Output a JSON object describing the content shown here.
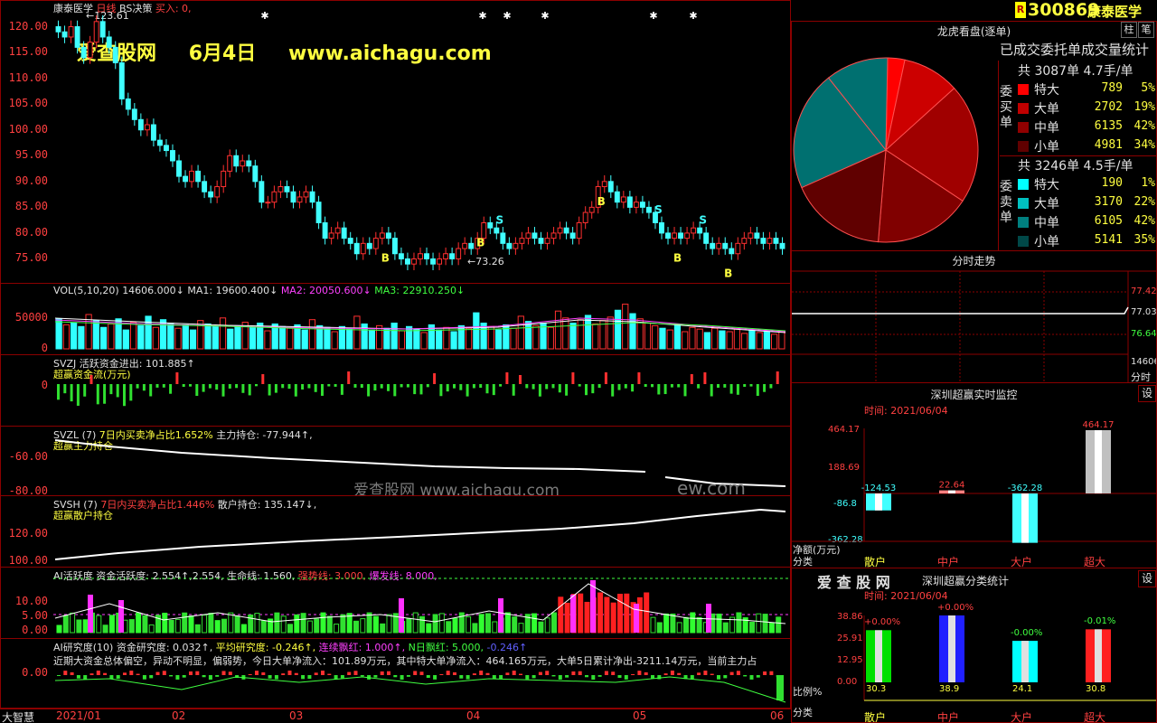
{
  "stock": {
    "code": "300869",
    "name": "康泰医学",
    "period": "日线",
    "strategy": "BS决策",
    "buy_label": "买入: 0,"
  },
  "overlay": {
    "brand": "爱查股网",
    "date": "6月4日",
    "url": "www.aichagu.com",
    "watermark": "爱查股网   www.aichagu.com",
    "watermark2": "ew.com"
  },
  "main_chart": {
    "y_ticks": [
      "120.00",
      "115.00",
      "110.00",
      "105.00",
      "100.00",
      "95.00",
      "90.00",
      "85.00",
      "80.00",
      "75.00"
    ],
    "high_label": "←123.61",
    "low_label": "←73.26",
    "buy_marker": "B",
    "sell_marker": "S",
    "closes": [
      119,
      118,
      120,
      116,
      114,
      117,
      121,
      118,
      116,
      113,
      106,
      104,
      102,
      100,
      101,
      98,
      97,
      96,
      94,
      91,
      90,
      92,
      90,
      88,
      87,
      89,
      92,
      95,
      93,
      94,
      93,
      90,
      86,
      86,
      88,
      89,
      88,
      86,
      87,
      88,
      86,
      82,
      79,
      80,
      81,
      79,
      78,
      76,
      78,
      77,
      79,
      80,
      79,
      76,
      75,
      74,
      75,
      76,
      75,
      74,
      75,
      76,
      75,
      77,
      78,
      77,
      79,
      82,
      81,
      80,
      78,
      77,
      78,
      79,
      80,
      79,
      78,
      79,
      80,
      81,
      80,
      79,
      82,
      84,
      85,
      89,
      90,
      88,
      86,
      87,
      85,
      86,
      85,
      84,
      82,
      80,
      79,
      80,
      79,
      80,
      81,
      80,
      78,
      77,
      78,
      77,
      76,
      78,
      79,
      80,
      79,
      78,
      79,
      78,
      77
    ]
  },
  "volume": {
    "title": "VOL(5,10,20)",
    "value": "14606.000↓",
    "ma1": "MA1: 19600.400↓",
    "ma2": "MA2: 20050.600↓",
    "ma3": "MA3: 22910.250↓",
    "y_ticks": [
      "50000",
      "0"
    ],
    "values": [
      35,
      28,
      30,
      26,
      40,
      33,
      25,
      29,
      35,
      22,
      31,
      27,
      38,
      25,
      34,
      30,
      24,
      28,
      22,
      33,
      29,
      26,
      36,
      23,
      27,
      31,
      25,
      30,
      21,
      29,
      26,
      24,
      28,
      22,
      34,
      27,
      25,
      20,
      26,
      23,
      38,
      29,
      22,
      27,
      24,
      30,
      21,
      26,
      23,
      19,
      28,
      22,
      25,
      20,
      27,
      24,
      42,
      30,
      26,
      22,
      28,
      24,
      38,
      32,
      27,
      30,
      25,
      44,
      36,
      30,
      34,
      39,
      29,
      33,
      37,
      45,
      52,
      41,
      35,
      30,
      27,
      24,
      22,
      28,
      20,
      25,
      23,
      19,
      24,
      21,
      20,
      23,
      18,
      22,
      19,
      21,
      17,
      20
    ]
  },
  "svzj": {
    "title": "SVZJ",
    "name": "活跃资金进出: 101.885↑",
    "line2": "超赢资金流(万元)",
    "y_ticks": [
      "0"
    ]
  },
  "svzl": {
    "title": "SVZL (7)",
    "ratio": "7日内买卖净占比1.652%",
    "hold": "主力持仓: -77.944↑,",
    "line2": "超赢主力持仓",
    "y_ticks": [
      "-60.00",
      "-80.00"
    ]
  },
  "svsh": {
    "title": "SVSH (7)",
    "ratio": "7日内买卖净占比1.446%",
    "hold": "散户持仓: 135.147↓,",
    "line2": "超赢散户持仓",
    "y_ticks": [
      "120.00",
      "100.00"
    ]
  },
  "ai_active": {
    "title": "AI活跃度",
    "fund": "资金活跃度: 2.554↑,2.554,",
    "life": "生命线: 1.560,",
    "strong": "强势线: 3.000,",
    "burst": "爆发线: 8.000,",
    "y_ticks": [
      "10.00",
      "5.00",
      "0.00"
    ]
  },
  "ai_research": {
    "title": "AI研究度(10)",
    "fund": "资金研究度: 0.032↑,",
    "avg": "平均研究度: -0.246↑,",
    "red": "连续飘红: 1.000↑,",
    "nred": "N日飘红: 5.000,",
    "nval": "-0.246↑",
    "y_ticks": [
      "0.00"
    ],
    "comment": "近期大资金总体偏空，异动不明显，偏弱势，今日大单净流入：101.89万元，其中特大单净流入：464.165万元，大单5日累计净出-3211.14万元，当前主力占"
  },
  "x_axis": {
    "left_label": "大智慧",
    "ticks": [
      "2021/01",
      "02",
      "03",
      "04",
      "05",
      "06"
    ]
  },
  "header_right": {
    "flag": "R",
    "btn1": "柱",
    "btn2": "笔"
  },
  "lhb": {
    "title": "龙虎看盘(逐单)",
    "subtitle": "已成交委托单成交量统计",
    "buy_label": "委买单",
    "sell_label": "委卖单",
    "buy_total": "共 3087单 4.7手/单",
    "sell_total": "共 3246单 4.5手/单",
    "buy_rows": [
      {
        "name": "特大",
        "count": "789",
        "pct": "5%",
        "color": "#ff0000"
      },
      {
        "name": "大单",
        "count": "2702",
        "pct": "19%",
        "color": "#c00000"
      },
      {
        "name": "中单",
        "count": "6135",
        "pct": "42%",
        "color": "#900000"
      },
      {
        "name": "小单",
        "count": "4981",
        "pct": "34%",
        "color": "#600000"
      }
    ],
    "sell_rows": [
      {
        "name": "特大",
        "count": "190",
        "pct": "1%",
        "color": "#00ffff"
      },
      {
        "name": "大单",
        "count": "3170",
        "pct": "22%",
        "color": "#00c0c0"
      },
      {
        "name": "中单",
        "count": "6105",
        "pct": "42%",
        "color": "#008080"
      },
      {
        "name": "小单",
        "count": "5141",
        "pct": "35%",
        "color": "#004848"
      }
    ],
    "pie_slices": [
      {
        "value": 3,
        "color": "#ff0000"
      },
      {
        "value": 10,
        "color": "#cc0000"
      },
      {
        "value": 21,
        "color": "#a00000"
      },
      {
        "value": 17,
        "color": "#800000"
      },
      {
        "value": 17,
        "color": "#600000"
      },
      {
        "value": 21,
        "color": "#007070"
      },
      {
        "value": 11,
        "color": "#007070"
      }
    ]
  },
  "fenshi": {
    "title": "分时走势",
    "ticks": [
      "77.42",
      "77.03",
      "76.64"
    ],
    "vol": "14606",
    "vol_label": "分时"
  },
  "monitor": {
    "title": "深圳超赢实时监控",
    "set": "设",
    "time": "时间: 2021/06/04",
    "y_ticks": [
      "464.17",
      "188.69",
      "-86.8",
      "-362.28"
    ],
    "unit": "净额(万元)",
    "cat_label": "分类",
    "categories": [
      "散户",
      "中户",
      "大户",
      "超大"
    ],
    "values": [
      -124.53,
      22.64,
      -362.28,
      464.17
    ],
    "value_labels": [
      "-124.53",
      "22.64",
      "-362.28",
      "464.17"
    ]
  },
  "classify": {
    "brand": "爱 查 股 网",
    "title": "深圳超赢分类统计",
    "set": "设",
    "time": "时间: 2021/06/04",
    "y_ticks": [
      "38.86",
      "25.91",
      "12.95",
      "0.00"
    ],
    "ratio_label": "比例%",
    "cat_label": "分类",
    "categories": [
      "散户",
      "中户",
      "大户",
      "超大"
    ],
    "values": [
      30.3,
      38.9,
      24.1,
      30.8
    ],
    "value_labels": [
      "30.3",
      "38.9",
      "24.1",
      "30.8"
    ],
    "changes": [
      "+0.00%",
      "+0.00%",
      "-0.00%",
      "-0.01%"
    ],
    "colors": [
      "#00e000",
      "#2020ff",
      "#00ffff",
      "#ff2020"
    ]
  }
}
